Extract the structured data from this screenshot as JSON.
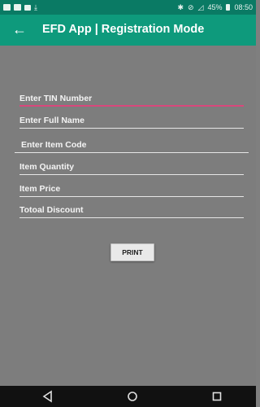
{
  "status_bar": {
    "left_icons": [
      "notification-icon",
      "image-icon",
      "lock-icon",
      "download-icon"
    ],
    "bluetooth_icon": "bluetooth-icon",
    "battery_level": "45%",
    "time": "08:50"
  },
  "app_bar": {
    "title": "EFD App | Registration Mode",
    "back_icon": "back-arrow-icon"
  },
  "form": {
    "tin_label": "Enter TIN Number",
    "name_label": "Enter Full Name",
    "item_code_label": "Enter Item Code",
    "quantity_label": "Item Quantity",
    "price_label": "Item Price",
    "discount_label": "Totoal Discount"
  },
  "print_button": "PRINT",
  "nav_bar": {
    "back": "back-triangle-icon",
    "home": "home-circle-icon",
    "recents": "recents-square-icon"
  },
  "colors": {
    "status_bar": "#0a7a64",
    "app_bar": "#0e9a7c",
    "background": "#7d7d7d",
    "active_underline": "#d9487c"
  }
}
